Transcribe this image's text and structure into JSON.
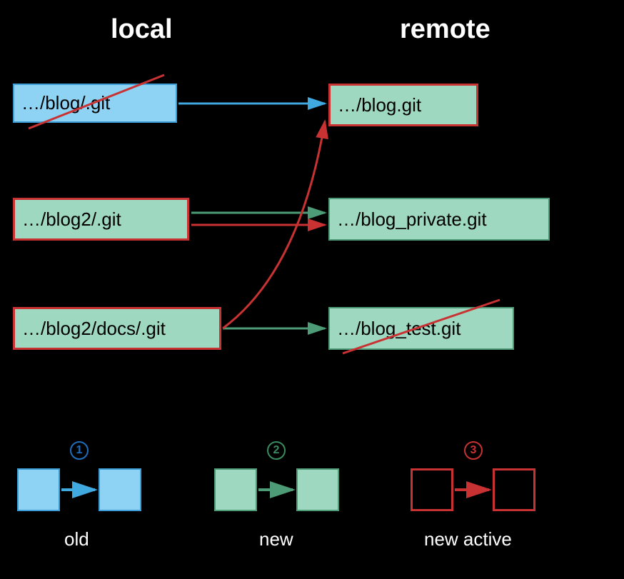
{
  "headers": {
    "local": "local",
    "remote": "remote"
  },
  "boxes": {
    "local1": "…/blog/.git",
    "local2": "…/blog2/.git",
    "local3": "…/blog2/docs/.git",
    "remote1": "…/blog.git",
    "remote2": "…/blog_private.git",
    "remote3": "…/blog_test.git"
  },
  "legend": {
    "n1": "1",
    "n2": "2",
    "n3": "3",
    "t1": "old",
    "t2": "new",
    "t3": "new active"
  },
  "colors": {
    "blue": "#3fa9e0",
    "green": "#4e9c77",
    "red": "#c93232"
  }
}
